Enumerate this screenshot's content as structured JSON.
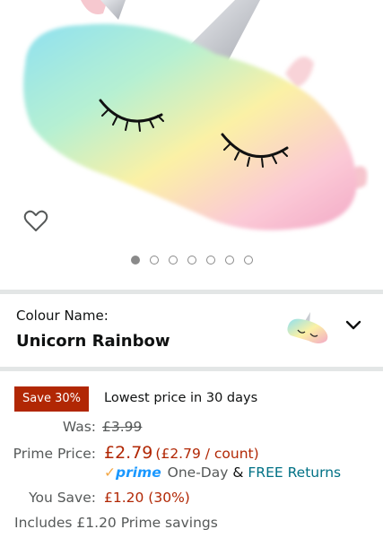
{
  "product_image": {
    "alt": "unicorn sleep mask",
    "carousel_count": 7,
    "active_index": 0
  },
  "icons": {
    "wishlist": "heart-outline-icon",
    "dropdown": "chevron-down-icon",
    "check": "check-icon"
  },
  "colour": {
    "label": "Colour Name:",
    "value": "Unicorn Rainbow"
  },
  "deal": {
    "badge": "Save 30%",
    "badge_color": "#b12704",
    "lowest_text": "Lowest price in 30 days"
  },
  "price": {
    "was_label": "Was:",
    "was_value": "£3.99",
    "prime_label": "Prime Price:",
    "prime_value": "£2.79",
    "unit_price": "(£2.79 / count)",
    "check": "✓",
    "prime_text": "prime",
    "one_day": "One-Day",
    "amp": "&",
    "free_returns": "FREE Returns",
    "save_label": "You Save:",
    "save_value": "£1.20 (30%)",
    "includes": "Includes £1.20 Prime savings"
  },
  "colors": {
    "price_red": "#b12704",
    "link_teal": "#007185",
    "prime_blue": "#1a98ff",
    "check_orange": "#f3a847"
  }
}
